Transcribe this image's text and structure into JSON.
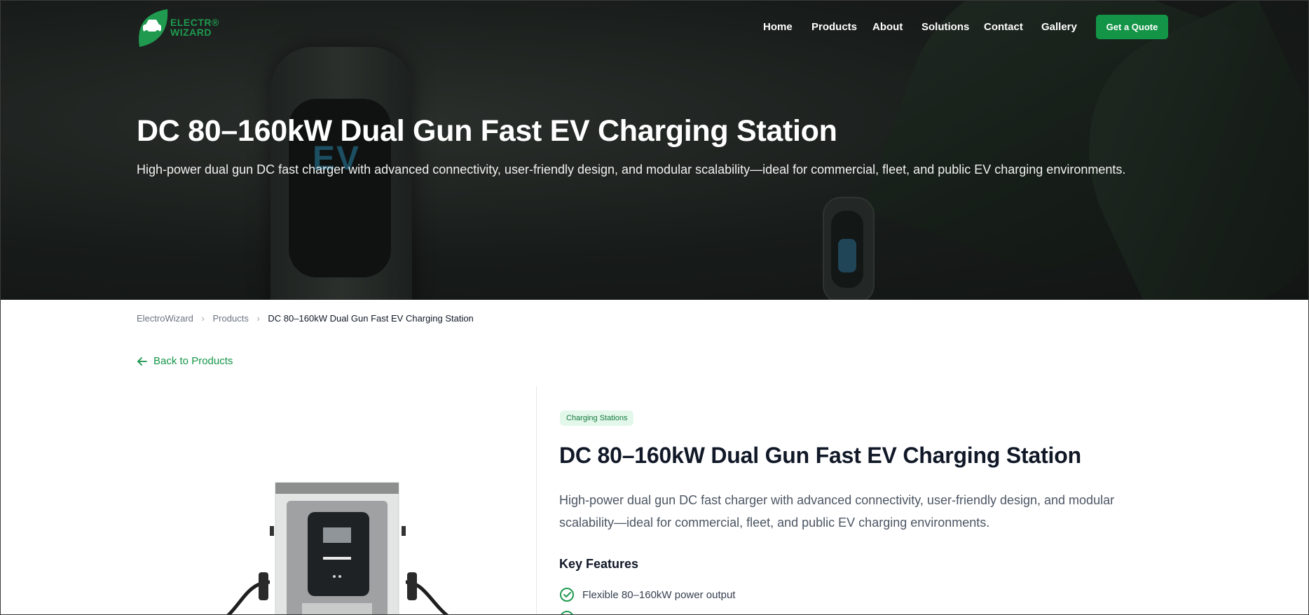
{
  "nav": {
    "logo_text_line1": "ELECTR®",
    "logo_text_line2": "WIZARD",
    "links": [
      "Home",
      "Products",
      "About",
      "Solutions",
      "Contact",
      "Gallery"
    ],
    "cta": "Get a Quote"
  },
  "hero": {
    "title": "DC 80–160kW Dual Gun Fast EV Charging Station",
    "subtitle": "High-power dual gun DC fast charger with advanced connectivity, user-friendly design, and modular scalability—ideal for commercial, fleet, and public EV charging environments.",
    "charger_label": "EV"
  },
  "breadcrumb": {
    "home": "ElectroWizard",
    "section": "Products",
    "current": "DC 80–160kW Dual Gun Fast EV Charging Station",
    "separator": "›"
  },
  "back_link": "Back to Products",
  "product": {
    "category": "Charging Stations",
    "title": "DC 80–160kW Dual Gun Fast EV Charging Station",
    "description": "High-power dual gun DC fast charger with advanced connectivity, user-friendly design, and modular scalability—ideal for commercial, fleet, and public EV charging environments.",
    "key_features_heading": "Key Features",
    "features": [
      "Flexible 80–160kW power output",
      ""
    ]
  },
  "colors": {
    "brand_green": "#149447",
    "hero_bg": "#171b19",
    "badge_bg": "#e3f7ea"
  }
}
